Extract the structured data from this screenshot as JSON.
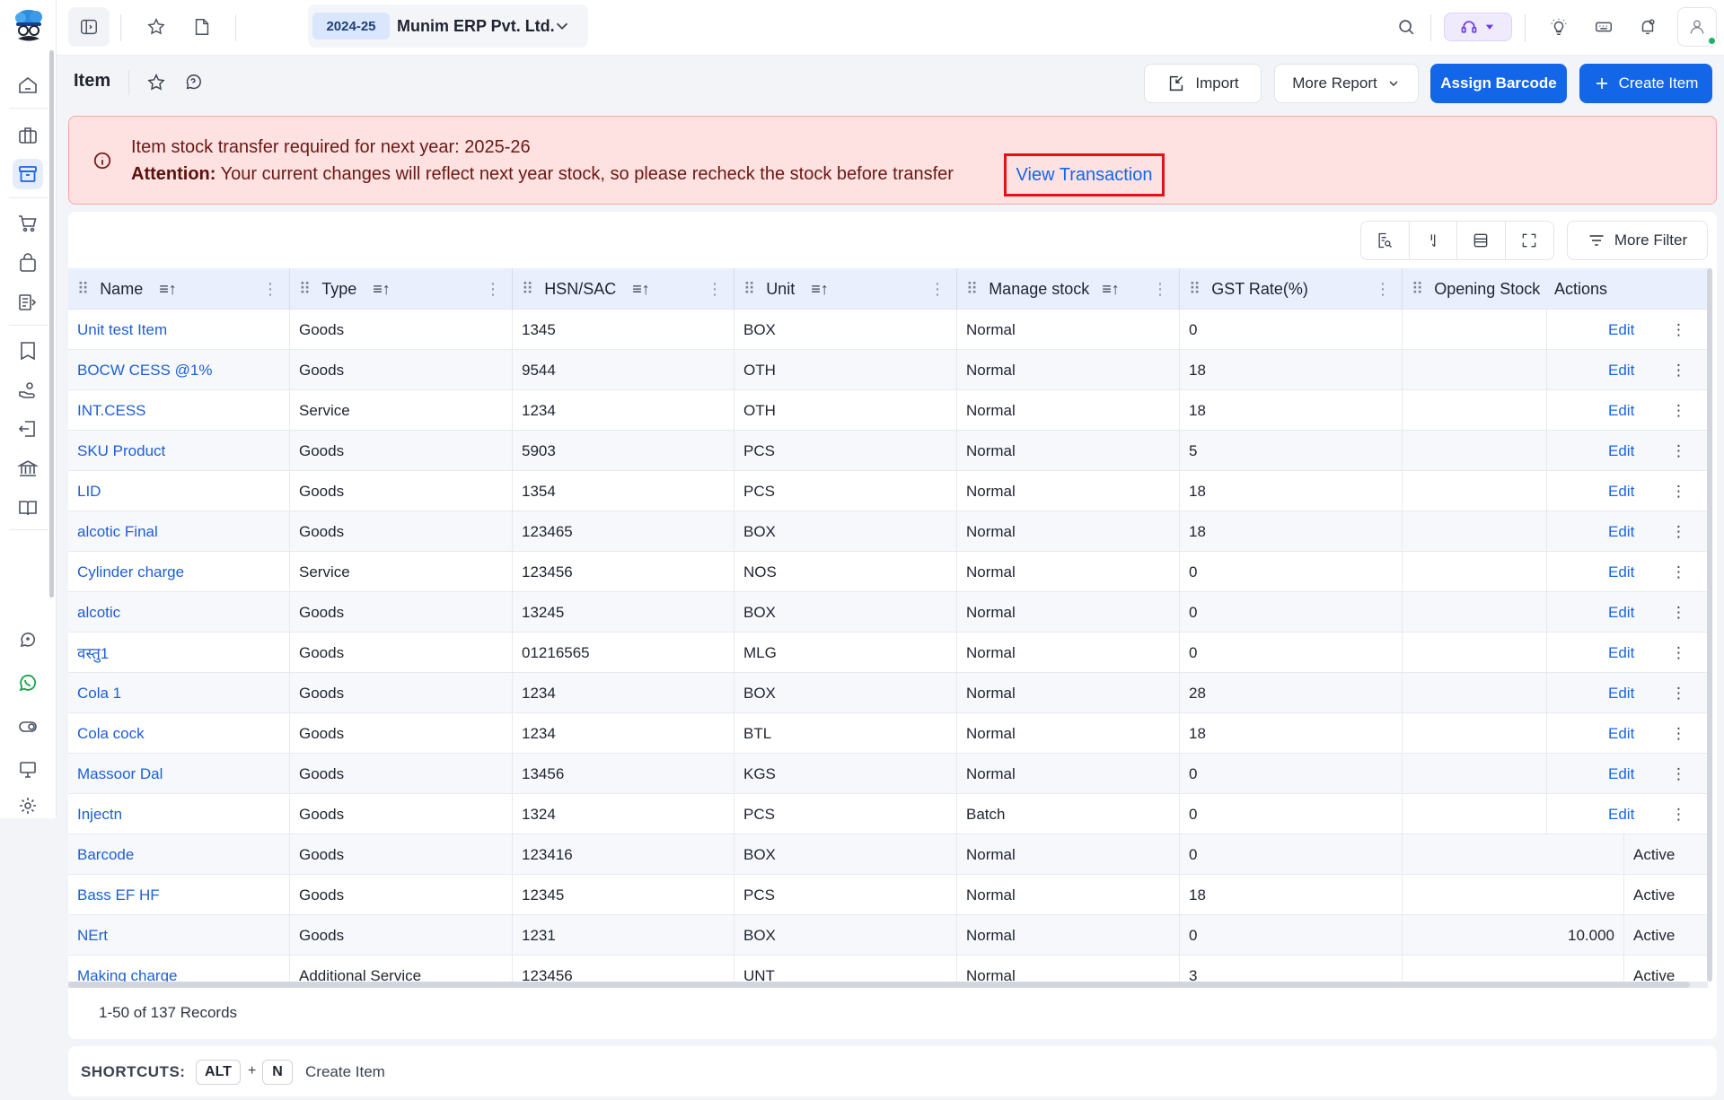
{
  "topbar": {
    "financial_year": "2024-25",
    "company_name": "Munim ERP Pvt. Ltd."
  },
  "page": {
    "title": "Item",
    "import_label": "Import",
    "more_report_label": "More Report",
    "assign_barcode_label": "Assign Barcode",
    "create_item_label": "Create Item"
  },
  "alert": {
    "title": "Item stock transfer required for next year: 2025-26",
    "attention_label": "Attention:",
    "message": "Your current changes will reflect next year stock, so please recheck the stock before transfer",
    "link": "View Transaction"
  },
  "table": {
    "more_filter_label": "More Filter",
    "columns": [
      "Name",
      "Type",
      "HSN/SAC",
      "Unit",
      "Manage stock",
      "GST Rate(%)",
      "Opening Stock",
      "Actions"
    ],
    "edit_label": "Edit",
    "rows": [
      {
        "name": "Unit test Item",
        "type": "Goods",
        "hsn": "1345",
        "unit": "BOX",
        "stock": "Normal",
        "gst": "0",
        "opening": "",
        "status": ""
      },
      {
        "name": "BOCW CESS @1%",
        "type": "Goods",
        "hsn": "9544",
        "unit": "OTH",
        "stock": "Normal",
        "gst": "18",
        "opening": "",
        "status": ""
      },
      {
        "name": "INT.CESS",
        "type": "Service",
        "hsn": "1234",
        "unit": "OTH",
        "stock": "Normal",
        "gst": "18",
        "opening": "",
        "status": ""
      },
      {
        "name": "SKU Product",
        "type": "Goods",
        "hsn": "5903",
        "unit": "PCS",
        "stock": "Normal",
        "gst": "5",
        "opening": "",
        "status": ""
      },
      {
        "name": "LID",
        "type": "Goods",
        "hsn": "1354",
        "unit": "PCS",
        "stock": "Normal",
        "gst": "18",
        "opening": "",
        "status": ""
      },
      {
        "name": "alcotic Final",
        "type": "Goods",
        "hsn": "123465",
        "unit": "BOX",
        "stock": "Normal",
        "gst": "18",
        "opening": "",
        "status": ""
      },
      {
        "name": "Cylinder charge",
        "type": "Service",
        "hsn": "123456",
        "unit": "NOS",
        "stock": "Normal",
        "gst": "0",
        "opening": "",
        "status": ""
      },
      {
        "name": "alcotic",
        "type": "Goods",
        "hsn": "13245",
        "unit": "BOX",
        "stock": "Normal",
        "gst": "0",
        "opening": "",
        "status": ""
      },
      {
        "name": "वस्तु1",
        "type": "Goods",
        "hsn": "01216565",
        "unit": "MLG",
        "stock": "Normal",
        "gst": "0",
        "opening": "",
        "status": ""
      },
      {
        "name": "Cola 1",
        "type": "Goods",
        "hsn": "1234",
        "unit": "BOX",
        "stock": "Normal",
        "gst": "28",
        "opening": "",
        "status": ""
      },
      {
        "name": "Cola cock",
        "type": "Goods",
        "hsn": "1234",
        "unit": "BTL",
        "stock": "Normal",
        "gst": "18",
        "opening": "",
        "status": ""
      },
      {
        "name": "Massoor Dal",
        "type": "Goods",
        "hsn": "13456",
        "unit": "KGS",
        "stock": "Normal",
        "gst": "0",
        "opening": "",
        "status": ""
      },
      {
        "name": "Injectn",
        "type": "Goods",
        "hsn": "1324",
        "unit": "PCS",
        "stock": "Batch",
        "gst": "0",
        "opening": "",
        "status": ""
      },
      {
        "name": "Barcode",
        "type": "Goods",
        "hsn": "123416",
        "unit": "BOX",
        "stock": "Normal",
        "gst": "0",
        "opening": "",
        "status": "Active"
      },
      {
        "name": "Bass EF HF",
        "type": "Goods",
        "hsn": "12345",
        "unit": "PCS",
        "stock": "Normal",
        "gst": "18",
        "opening": "",
        "status": "Active"
      },
      {
        "name": "NErt",
        "type": "Goods",
        "hsn": "1231",
        "unit": "BOX",
        "stock": "Normal",
        "gst": "0",
        "opening": "10.000",
        "status": "Active"
      },
      {
        "name": "Making charge",
        "type": "Additional Service",
        "hsn": "123456",
        "unit": "UNT",
        "stock": "Normal",
        "gst": "3",
        "opening": "",
        "status": "Active"
      }
    ],
    "records_label": "1-50 of 137 Records"
  },
  "shortcuts": {
    "label": "SHORTCUTS:",
    "key1": "ALT",
    "plus": "+",
    "key2": "N",
    "action": "Create Item"
  }
}
